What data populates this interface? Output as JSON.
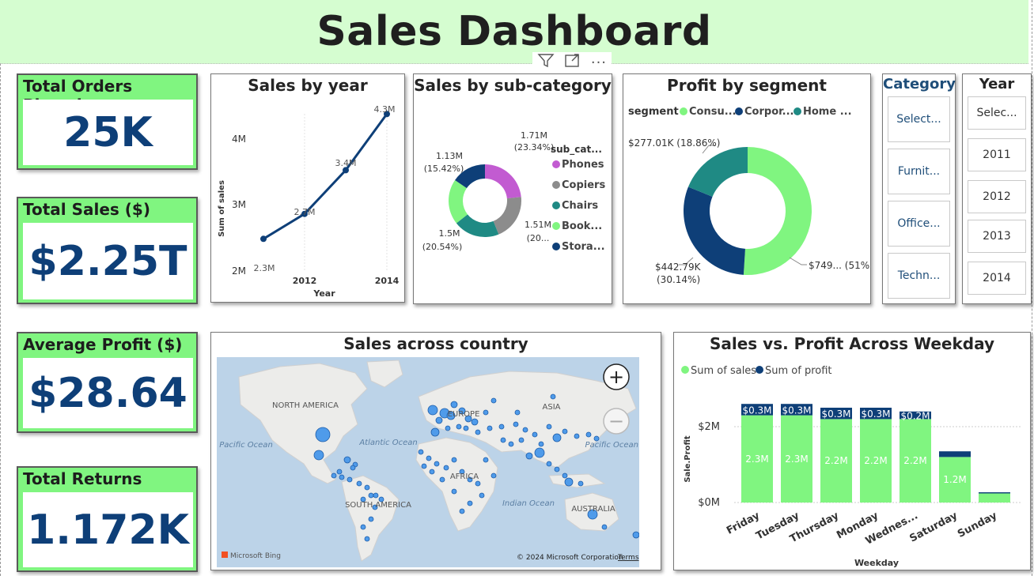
{
  "header": {
    "title": "Sales Dashboard"
  },
  "kpis": [
    {
      "title": "Total Orders Placed",
      "value": "25K"
    },
    {
      "title": "Total Sales ($)",
      "value": "$2.25T"
    },
    {
      "title": "Average Profit ($)",
      "value": "$28.64"
    },
    {
      "title": "Total Returns",
      "value": "1.172K"
    }
  ],
  "sales_by_year": {
    "title": "Sales by year",
    "ylabel": "Sum of sales",
    "xlabel": "Year",
    "yticks": [
      "4M",
      "3M",
      "2M"
    ],
    "xticks": [
      "2012",
      "2014"
    ],
    "labels": [
      "2.3M",
      "2.7M",
      "3.4M",
      "4.3M"
    ]
  },
  "sub_category": {
    "title": "Sales by sub-category",
    "legend_title": "sub_cat...",
    "legend": [
      "Phones",
      "Copiers",
      "Chairs",
      "Book...",
      "Stora..."
    ],
    "colors": [
      "#c25bd1",
      "#8c8c8c",
      "#1f8a84",
      "#80f580",
      "#0e3f78"
    ],
    "labels": [
      {
        "v": "1.71M",
        "p": "(23.34%)"
      },
      {
        "v": "1.51M",
        "p": "(20..."
      },
      {
        "v": "1.5M",
        "p": "(20.54%)"
      },
      {
        "v": "1.13M",
        "p": "(15.42%)"
      }
    ]
  },
  "segment": {
    "title": "Profit by segment",
    "legend_title": "segment",
    "legend": [
      "Consu...",
      "Corpor...",
      "Home ..."
    ],
    "colors": [
      "#80f580",
      "#0e3f78",
      "#1f8a84"
    ],
    "label_consumer": "$749... (51%)",
    "label_corporate_v": "$442.79K",
    "label_corporate_p": "(30.14%)",
    "label_home": "$277.01K (18.86%)"
  },
  "category_slicer": {
    "title": "Category",
    "items": [
      "Select...",
      "Furnit...",
      "Office...",
      "Techn..."
    ]
  },
  "year_slicer": {
    "title": "Year",
    "items": [
      "Selec...",
      "2011",
      "2012",
      "2013",
      "2014"
    ]
  },
  "map": {
    "title": "Sales across country",
    "continents": [
      "NORTH AMERICA",
      "EUROPE",
      "ASIA",
      "AFRICA",
      "SOUTH AMERICA",
      "AUSTRALIA"
    ],
    "oceans": [
      "Pacific Ocean",
      "Atlantic Ocean",
      "Indian Ocean",
      "Pacific Ocean"
    ],
    "bing": "Microsoft Bing",
    "copyright": "© 2024 Microsoft Corporation",
    "terms": "Terms",
    "zoom_in": "+",
    "zoom_out": "−"
  },
  "weekday": {
    "title": "Sales vs. Profit Across Weekday",
    "legend": [
      "Sum of sales",
      "Sum of profit"
    ],
    "ylabel": "Sale.Profit",
    "xlabel": "Weekday",
    "yticks": [
      "$2M",
      "$0M"
    ],
    "colors": {
      "sales": "#80f580",
      "profit": "#0e3f78"
    }
  },
  "chart_data": [
    {
      "type": "line",
      "title": "Sales by year",
      "x": [
        2011,
        2012,
        2013,
        2014
      ],
      "values": [
        2.3,
        2.7,
        3.4,
        4.3
      ],
      "xlabel": "Year",
      "ylabel": "Sum of sales",
      "ylim": [
        2,
        4.3
      ]
    },
    {
      "type": "pie",
      "title": "Sales by sub-category",
      "categories": [
        "Phones",
        "Copiers",
        "Chairs",
        "Book...",
        "Stora..."
      ],
      "values": [
        23.34,
        20.5,
        20.54,
        20.2,
        15.42
      ]
    },
    {
      "type": "pie",
      "title": "Profit by segment",
      "categories": [
        "Consu...",
        "Corpor...",
        "Home ..."
      ],
      "values": [
        51,
        30.14,
        18.86
      ]
    },
    {
      "type": "bar",
      "title": "Sales vs. Profit Across Weekday",
      "categories": [
        "Friday",
        "Tuesday",
        "Thursday",
        "Monday",
        "Wednes...",
        "Saturday",
        "Sunday"
      ],
      "series": [
        {
          "name": "Sum of sales",
          "values": [
            2.3,
            2.3,
            2.2,
            2.2,
            2.2,
            1.2,
            0.24
          ],
          "labels": [
            "2.3M",
            "2.3M",
            "2.2M",
            "2.2M",
            "2.2M",
            "1.2M",
            ""
          ]
        },
        {
          "name": "Sum of profit",
          "values": [
            0.3,
            0.3,
            0.3,
            0.3,
            0.2,
            0.15,
            0.03
          ],
          "labels": [
            "$0.3M",
            "$0.3M",
            "$0.3M",
            "$0.3M",
            "$0.2M",
            "",
            ""
          ]
        }
      ],
      "xlabel": "Weekday",
      "ylabel": "Sale.Profit",
      "ylim": [
        0,
        2.6
      ]
    }
  ]
}
